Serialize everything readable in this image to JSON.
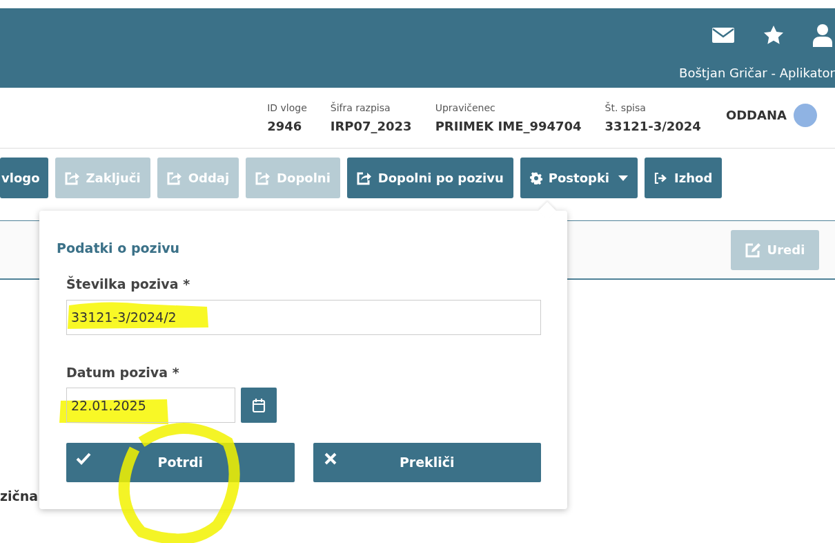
{
  "header": {
    "user": "Boštjan Gričar - Aplikator"
  },
  "info": [
    {
      "label": "ID vloge",
      "value": "2946"
    },
    {
      "label": "Šifra razpisa",
      "value": "IRP07_2023"
    },
    {
      "label": "Upravičenec",
      "value": "PRIIMEK IME_994704"
    },
    {
      "label": "Št. spisa",
      "value": "33121-3/2024"
    }
  ],
  "status": {
    "text": "ODDANA",
    "color": "#8fb3e3"
  },
  "toolbar": [
    {
      "kind": "plain",
      "label": "vlogo",
      "disabled": false
    },
    {
      "kind": "share",
      "label": "Zaključi",
      "disabled": true
    },
    {
      "kind": "share",
      "label": "Oddaj",
      "disabled": true
    },
    {
      "kind": "share",
      "label": "Dopolni",
      "disabled": true
    },
    {
      "kind": "share",
      "label": "Dopolni po pozivu",
      "disabled": false
    },
    {
      "kind": "menu",
      "label": "Postopki",
      "disabled": false
    },
    {
      "kind": "exit",
      "label": "Izhod",
      "disabled": false
    }
  ],
  "panel": {
    "edit_button": {
      "label": "Uredi",
      "disabled": true
    }
  },
  "background_text": "zična",
  "popover": {
    "title": "Podatki o pozivu",
    "fields": [
      {
        "label": "Številka poziva *",
        "value": "33121-3/2024/2"
      },
      {
        "label": "Datum poziva *",
        "value": "22.01.2025"
      }
    ],
    "buttons": [
      {
        "kind": "confirm",
        "label": "Potrdi"
      },
      {
        "kind": "cancel",
        "label": "Prekliči"
      }
    ]
  }
}
